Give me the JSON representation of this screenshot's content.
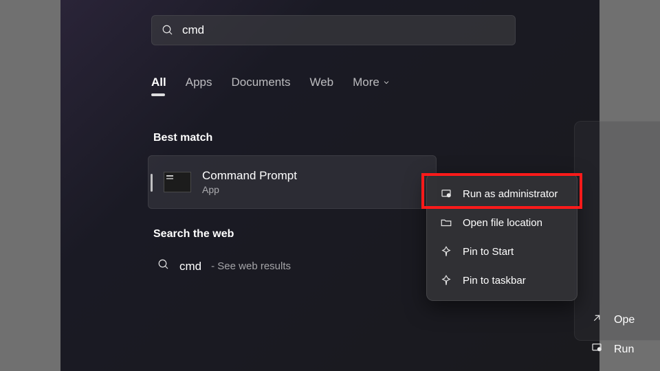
{
  "search": {
    "query": "cmd"
  },
  "filters": {
    "all": "All",
    "apps": "Apps",
    "documents": "Documents",
    "web": "Web",
    "more": "More"
  },
  "sections": {
    "best_match": "Best match",
    "search_web": "Search the web"
  },
  "best_match_result": {
    "title": "Command Prompt",
    "subtitle": "App"
  },
  "web_result": {
    "term": "cmd",
    "hint": "- See web results"
  },
  "context_menu": {
    "run_admin": "Run as administrator",
    "open_location": "Open file location",
    "pin_start": "Pin to Start",
    "pin_taskbar": "Pin to taskbar"
  },
  "side_actions": {
    "open": "Ope",
    "run": "Run"
  }
}
